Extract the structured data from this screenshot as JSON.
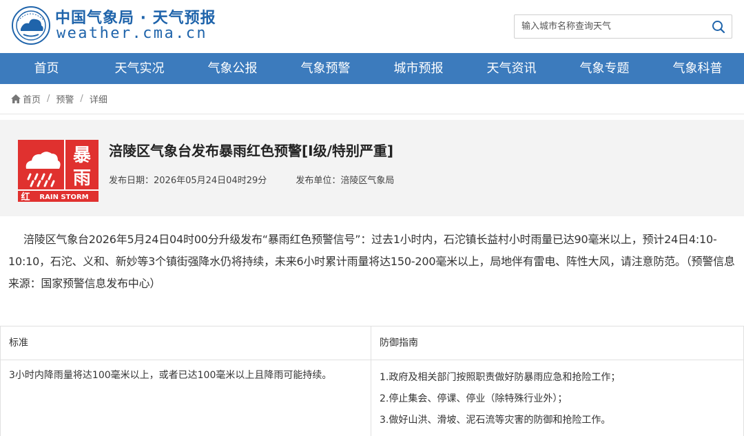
{
  "header": {
    "brand_cn": "中国气象局 · 天气预报",
    "brand_en": "weather.cma.cn",
    "search_placeholder": "输入城市名称查询天气"
  },
  "nav": {
    "items": [
      "首页",
      "天气实况",
      "气象公报",
      "气象预警",
      "城市预报",
      "天气资讯",
      "气象专题",
      "气象科普"
    ]
  },
  "breadcrumb": {
    "home": "首页",
    "level2": "预警",
    "level3": "详细"
  },
  "alert": {
    "icon_text_top": "暴",
    "icon_text_mid": "雨",
    "icon_text_level": "红",
    "icon_text_en": "RAIN STORM",
    "title": "涪陵区气象台发布暴雨红色预警[Ⅰ级/特别严重]",
    "date_label": "发布日期：2026年05月24日04时29分",
    "unit_label": "发布单位：涪陵区气象局",
    "colors": {
      "red": "#e0312f"
    }
  },
  "content": {
    "paragraph": "涪陵区气象台2026年5月24日04时00分升级发布“暴雨红色预警信号”：过去1小时内，石沱镇长益村小时雨量已达90毫米以上，预计24日4:10-10:10，石沱、义和、新妙等3个镇街强降水仍将持续，未来6小时累计雨量将达150-200毫米以上，局地伴有雷电、阵性大风，请注意防范。（预警信息来源：国家预警信息发布中心）"
  },
  "table": {
    "headers": [
      "标准",
      "防御指南"
    ],
    "standard": "3小时内降雨量将达100毫米以上，或者已达100毫米以上且降雨可能持续。",
    "guides": [
      "1.政府及相关部门按照职责做好防暴雨应急和抢险工作；",
      "2.停止集会、停课、停业（除特殊行业外）；",
      "3.做好山洪、滑坡、泥石流等灾害的防御和抢险工作。"
    ]
  },
  "theme": {
    "brand_blue": "#1f64ab",
    "nav_blue": "#3c7bbd"
  }
}
